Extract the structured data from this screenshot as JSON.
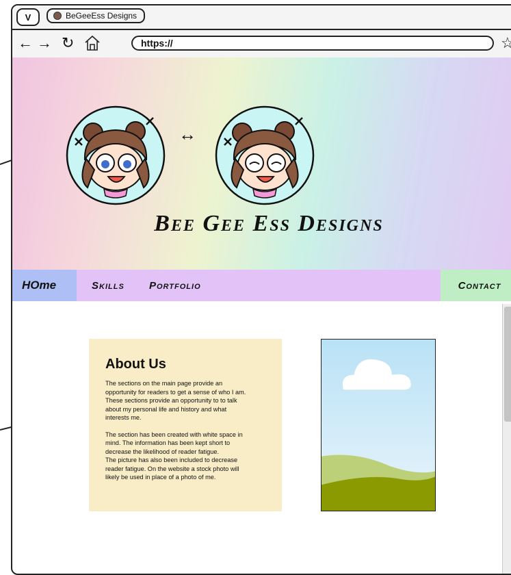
{
  "browser": {
    "v_button": "V",
    "tab_title": "BeGeeEss Designs",
    "url": "https://"
  },
  "icons": {
    "back": "arrow-left-icon",
    "forward": "arrow-right-icon",
    "reload": "reload-icon",
    "home": "home-icon",
    "bookmark": "star-icon"
  },
  "hero": {
    "swap_symbol": "↔",
    "brand": "Bee Gee Ess Designs"
  },
  "nav": {
    "home": "HOme",
    "skills": "Skills",
    "portfolio": "Portfolio",
    "contact": "Contact"
  },
  "about": {
    "heading": "About Us",
    "para1": "The sections on the main page provide an\nopportunity for readers to get a sense of who I am.\nThese sections provide an opportunity to to talk\nabout my personal life and history and what\ninterests me.",
    "para2": "The section has been created with white space in\nmind. The information has been kept short to\ndecrease the likelihood of reader fatigue.\nThe picture has also been included to decrease\nreader fatigue. On the website a stock photo will\nlikely be used in place of a photo of me."
  },
  "colors": {
    "nav_home_bg": "#aebff5",
    "nav_bg": "#e3c3f7",
    "nav_contact_bg": "#bfeec4",
    "about_bg": "#f8edc6",
    "sky": "#cde8f7",
    "grass": "#8a9a00"
  }
}
